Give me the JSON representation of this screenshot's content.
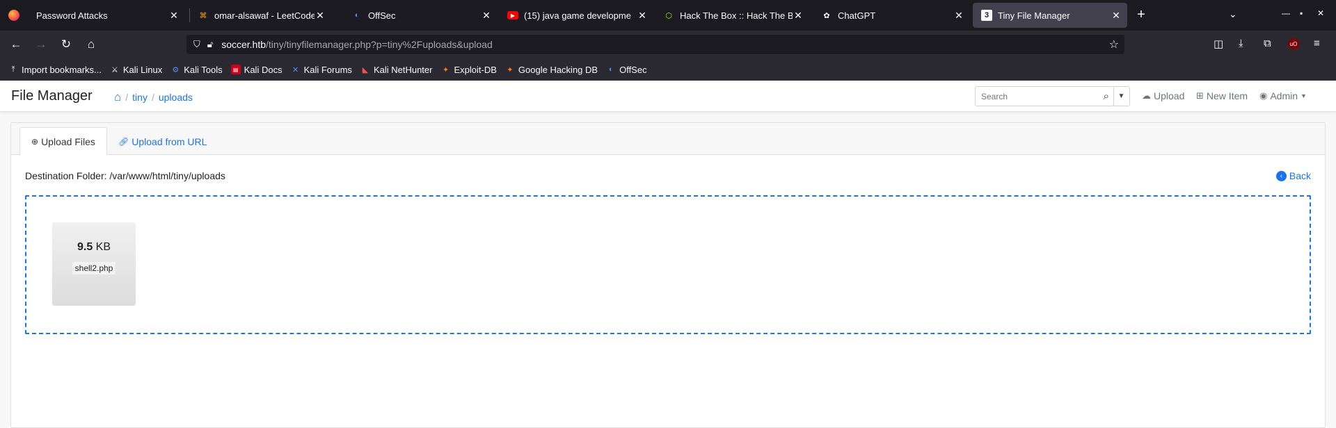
{
  "browser": {
    "tabs": [
      {
        "title": "Password Attacks",
        "active": false
      },
      {
        "title": "omar-alsawaf - LeetCode P",
        "active": false
      },
      {
        "title": "OffSec",
        "active": false
      },
      {
        "title": "(15) java game developme",
        "active": false
      },
      {
        "title": "Hack The Box :: Hack The B",
        "active": false
      },
      {
        "title": "ChatGPT",
        "active": false
      },
      {
        "title": "Tiny File Manager",
        "active": true
      }
    ],
    "url_host": "soccer.htb",
    "url_path": "/tiny/tinyfilemanager.php?p=tiny%2Fuploads&upload",
    "bookmarks": [
      {
        "label": "Import bookmarks...",
        "icon": "import-icon"
      },
      {
        "label": "Kali Linux",
        "icon": "kali-dragon-icon"
      },
      {
        "label": "Kali Tools",
        "icon": "kali-tools-icon"
      },
      {
        "label": "Kali Docs",
        "icon": "kali-docs-icon"
      },
      {
        "label": "Kali Forums",
        "icon": "kali-forums-icon"
      },
      {
        "label": "Kali NetHunter",
        "icon": "nethunter-icon"
      },
      {
        "label": "Exploit-DB",
        "icon": "exploitdb-icon"
      },
      {
        "label": "Google Hacking DB",
        "icon": "ghdb-icon"
      },
      {
        "label": "OffSec",
        "icon": "offsec-icon"
      }
    ]
  },
  "header": {
    "brand": "File Manager",
    "breadcrumb": [
      "tiny",
      "uploads"
    ],
    "search_placeholder": "Search",
    "upload_label": "Upload",
    "new_item_label": "New Item",
    "user_label": "Admin"
  },
  "upload": {
    "tab_files": "Upload Files",
    "tab_url": "Upload from URL",
    "destination": "Destination Folder: /var/www/html/tiny/uploads",
    "back_label": "Back",
    "file": {
      "size_value": "9.5",
      "size_unit": "KB",
      "name": "shell2.php"
    }
  }
}
